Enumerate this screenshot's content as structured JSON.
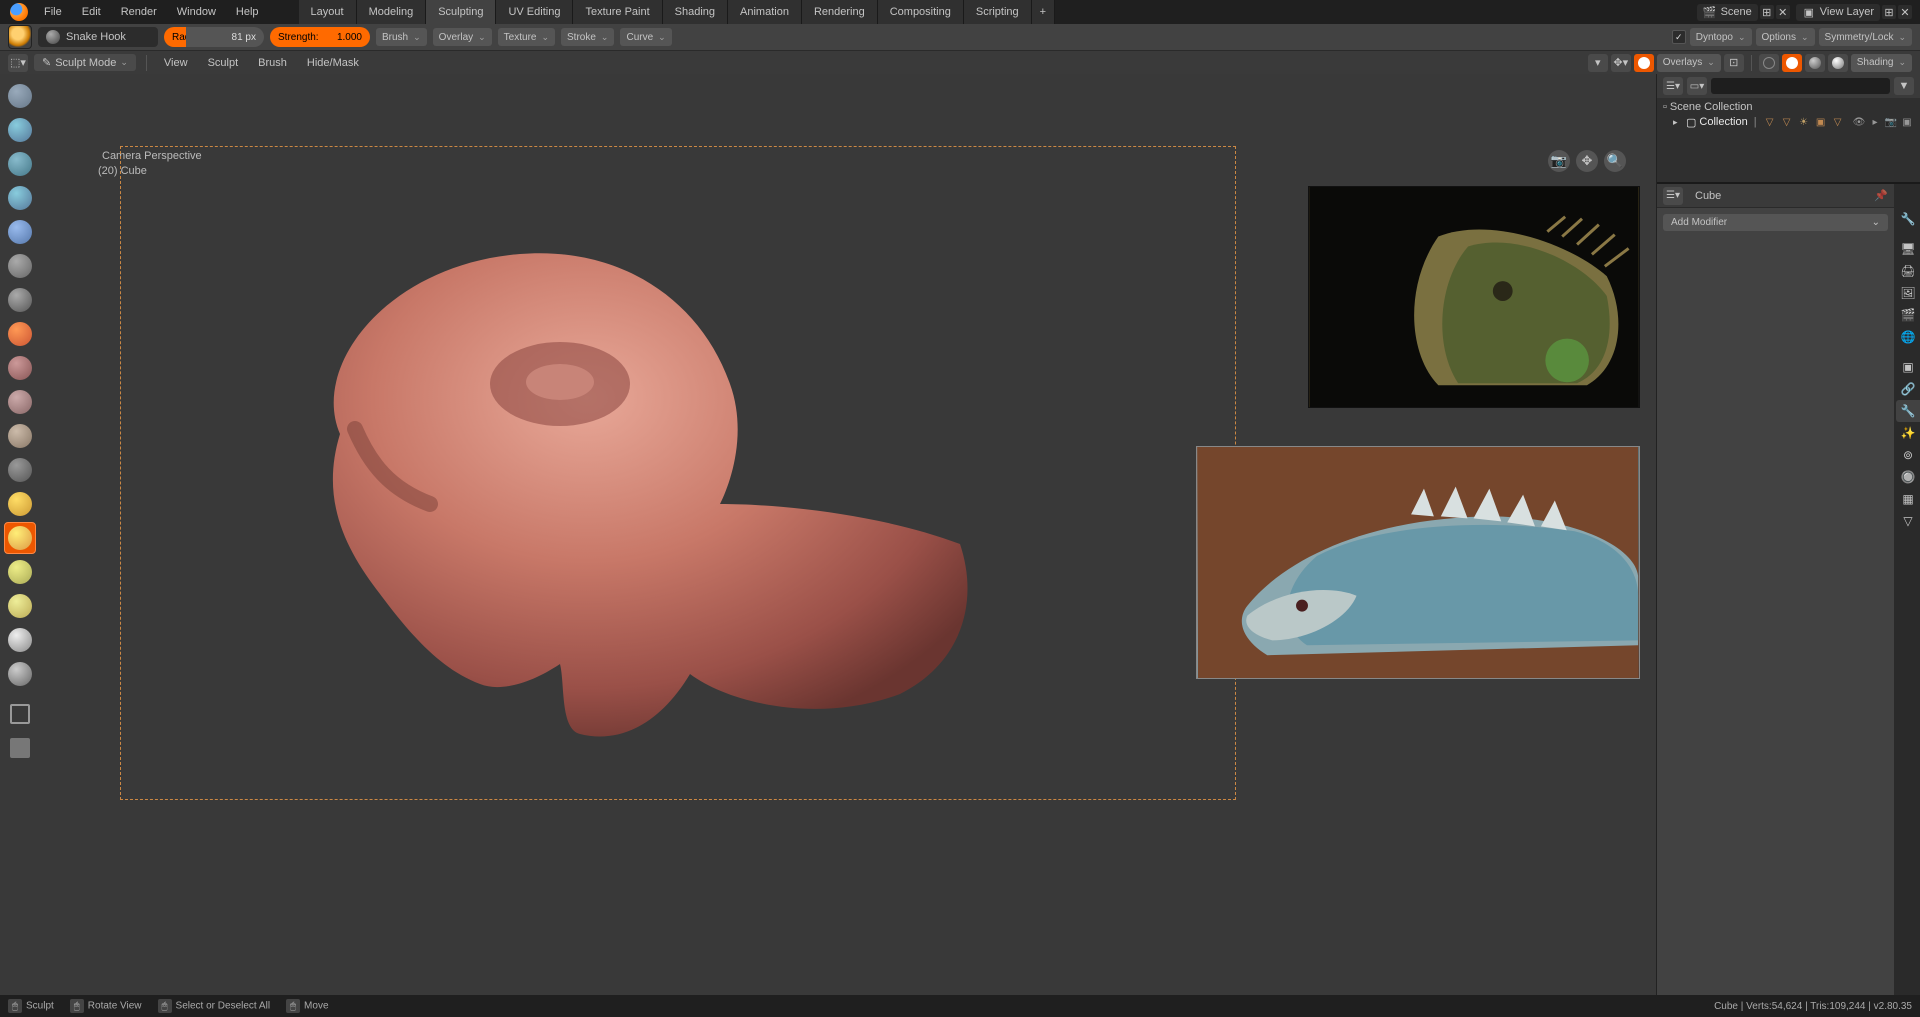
{
  "menu": {
    "file": "File",
    "edit": "Edit",
    "render": "Render",
    "window": "Window",
    "help": "Help"
  },
  "workspaces": [
    "Layout",
    "Modeling",
    "Sculpting",
    "UV Editing",
    "Texture Paint",
    "Shading",
    "Animation",
    "Rendering",
    "Compositing",
    "Scripting"
  ],
  "active_workspace": 2,
  "scene": {
    "label": "Scene",
    "layer": "View Layer"
  },
  "toolhdr": {
    "brush": "Snake Hook",
    "radius_label": "Radius:",
    "radius_val": "81 px",
    "strength_label": "Strength:",
    "strength_val": "1.000",
    "brush_dd": "Brush",
    "overlay_dd": "Overlay",
    "texture_dd": "Texture",
    "stroke_dd": "Stroke",
    "curve_dd": "Curve",
    "dyntopo": "Dyntopo",
    "options": "Options",
    "symmetry": "Symmetry/Lock"
  },
  "modehdr": {
    "mode": "Sculpt Mode",
    "view": "View",
    "sculpt": "Sculpt",
    "brush": "Brush",
    "hidemask": "Hide/Mask",
    "overlays": "Overlays",
    "shading": "Shading"
  },
  "viewport": {
    "persp": "Camera Perspective",
    "obj": "(20) Cube"
  },
  "outliner": {
    "scene_col": "Scene Collection",
    "collection": "Collection"
  },
  "props": {
    "obj": "Cube",
    "add_mod": "Add Modifier"
  },
  "status": {
    "sculpt": "Sculpt",
    "rotate": "Rotate View",
    "select": "Select or Deselect All",
    "move": "Move",
    "stats": "Cube | Verts:54,624 | Tris:109,244 | v2.80.35"
  }
}
